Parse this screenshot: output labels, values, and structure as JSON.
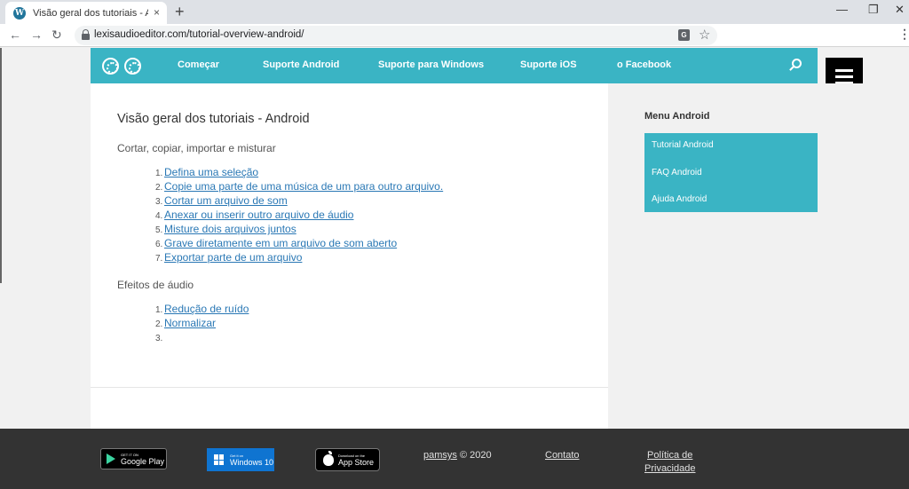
{
  "browser": {
    "tab_title": "Visão geral dos tutoriais - Android",
    "tab_close": "×",
    "new_tab": "+",
    "url": "lexisaudioeditor.com/tutorial-overview-android/",
    "translate_glyph": "G",
    "window_controls": [
      "—",
      "❐",
      "✕"
    ]
  },
  "site": {
    "nav": [
      "Começar",
      "Suporte Android",
      "Suporte para Windows",
      "Suporte iOS",
      "o Facebook"
    ]
  },
  "content": {
    "title": "Visão geral dos tutoriais - Android",
    "section1_heading": "Cortar, copiar, importar e misturar",
    "section1_items": [
      "Defina uma seleção",
      "Copie uma parte de uma música de um para outro arquivo.",
      "Cortar um arquivo de som",
      "Anexar ou inserir outro arquivo de áudio",
      "Misture dois arquivos juntos",
      "Grave diretamente em um arquivo de som aberto",
      "Exportar parte de um arquivo"
    ],
    "section2_heading": "Efeitos de áudio",
    "section2_items": [
      "Redução de ruído",
      "Normalizar",
      ""
    ]
  },
  "sidebar": {
    "title": "Menu Android",
    "items": [
      "Tutorial Android",
      "FAQ Android",
      "Ajuda Android"
    ]
  },
  "footer": {
    "google_play_small": "GET IT ON",
    "google_play_big": "Google Play",
    "windows_small": "Get it on",
    "windows_big": "Windows 10",
    "appstore_small": "Download on the",
    "appstore_big": "App Store",
    "copyright_link": "pamsys",
    "copyright_text": " © 2020",
    "contact": "Contato",
    "privacy_line1": "Política de",
    "privacy_line2": "Privacidade"
  },
  "colors": {
    "accent": "#3ab4c4",
    "link": "#2a78b5",
    "footer_bg": "#333333"
  }
}
